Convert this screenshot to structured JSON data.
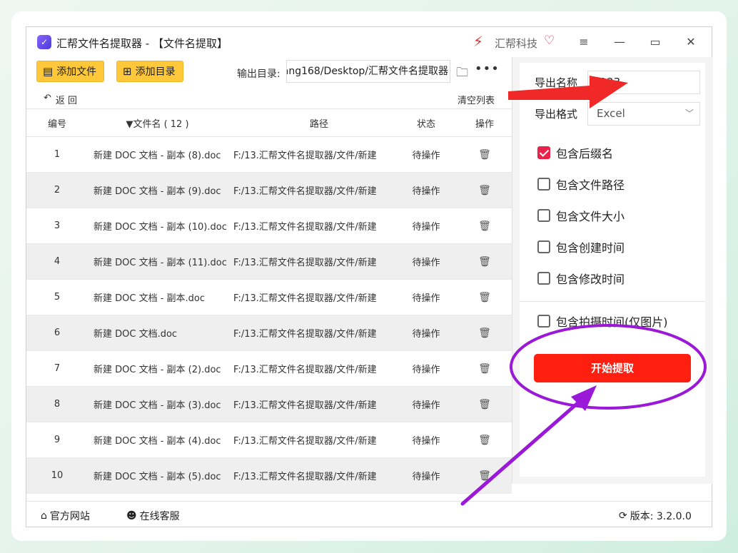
{
  "titlebar": {
    "title": "汇帮文件名提取器 - 【文件名提取】",
    "brand": "汇帮科技",
    "brand_icon": "lightning-icon",
    "badge_icon": "heart-badge-icon"
  },
  "toolbar": {
    "add_file": "添加文件",
    "add_dir": "添加目录",
    "output_label": "输出目录:",
    "output_path": "ang168/Desktop/汇帮文件名提取器",
    "back": "返  回",
    "clear": "清空列表"
  },
  "table": {
    "headers": {
      "num": "编号",
      "name": "▼文件名 ( 12 )",
      "path": "路径",
      "status": "状态",
      "op": "操作"
    },
    "rows": [
      {
        "num": "1",
        "name": "新建 DOC 文档 - 副本 (8).doc",
        "path": "F:/13.汇帮文件名提取器/文件/新建...",
        "status": "待操作"
      },
      {
        "num": "2",
        "name": "新建 DOC 文档 - 副本 (9).doc",
        "path": "F:/13.汇帮文件名提取器/文件/新建...",
        "status": "待操作"
      },
      {
        "num": "3",
        "name": "新建 DOC 文档 - 副本 (10).doc",
        "path": "F:/13.汇帮文件名提取器/文件/新建...",
        "status": "待操作"
      },
      {
        "num": "4",
        "name": "新建 DOC 文档 - 副本 (11).doc",
        "path": "F:/13.汇帮文件名提取器/文件/新建...",
        "status": "待操作"
      },
      {
        "num": "5",
        "name": "新建 DOC 文档 - 副本.doc",
        "path": "F:/13.汇帮文件名提取器/文件/新建...",
        "status": "待操作"
      },
      {
        "num": "6",
        "name": "新建 DOC 文档.doc",
        "path": "F:/13.汇帮文件名提取器/文件/新建...",
        "status": "待操作"
      },
      {
        "num": "7",
        "name": "新建 DOC 文档 - 副本 (2).doc",
        "path": "F:/13.汇帮文件名提取器/文件/新建...",
        "status": "待操作"
      },
      {
        "num": "8",
        "name": "新建 DOC 文档 - 副本 (3).doc",
        "path": "F:/13.汇帮文件名提取器/文件/新建...",
        "status": "待操作"
      },
      {
        "num": "9",
        "name": "新建 DOC 文档 - 副本 (4).doc",
        "path": "F:/13.汇帮文件名提取器/文件/新建...",
        "status": "待操作"
      },
      {
        "num": "10",
        "name": "新建 DOC 文档 - 副本 (5).doc",
        "path": "F:/13.汇帮文件名提取器/文件/新建...",
        "status": "待操作"
      }
    ]
  },
  "panel": {
    "export_name_label": "导出名称",
    "export_name_value": "1123",
    "export_format_label": "导出格式",
    "export_format_value": "Excel",
    "options": [
      {
        "label": "包含后缀名",
        "checked": true
      },
      {
        "label": "包含文件路径",
        "checked": false
      },
      {
        "label": "包含文件大小",
        "checked": false
      },
      {
        "label": "包含创建时间",
        "checked": false
      },
      {
        "label": "包含修改时间",
        "checked": false
      },
      {
        "label": "包含拍摄时间(仅图片)",
        "checked": false
      }
    ],
    "start": "开始提取"
  },
  "footer": {
    "website": "官方网站",
    "support": "在线客服",
    "version": "版本:  3.2.0.0"
  },
  "colors": {
    "accent_yellow": "#ffc83a",
    "start_red": "#ff1f10",
    "check_red": "#e8224a",
    "annotation_arrow_red": "#f02828",
    "annotation_purple": "#9a18d8"
  }
}
